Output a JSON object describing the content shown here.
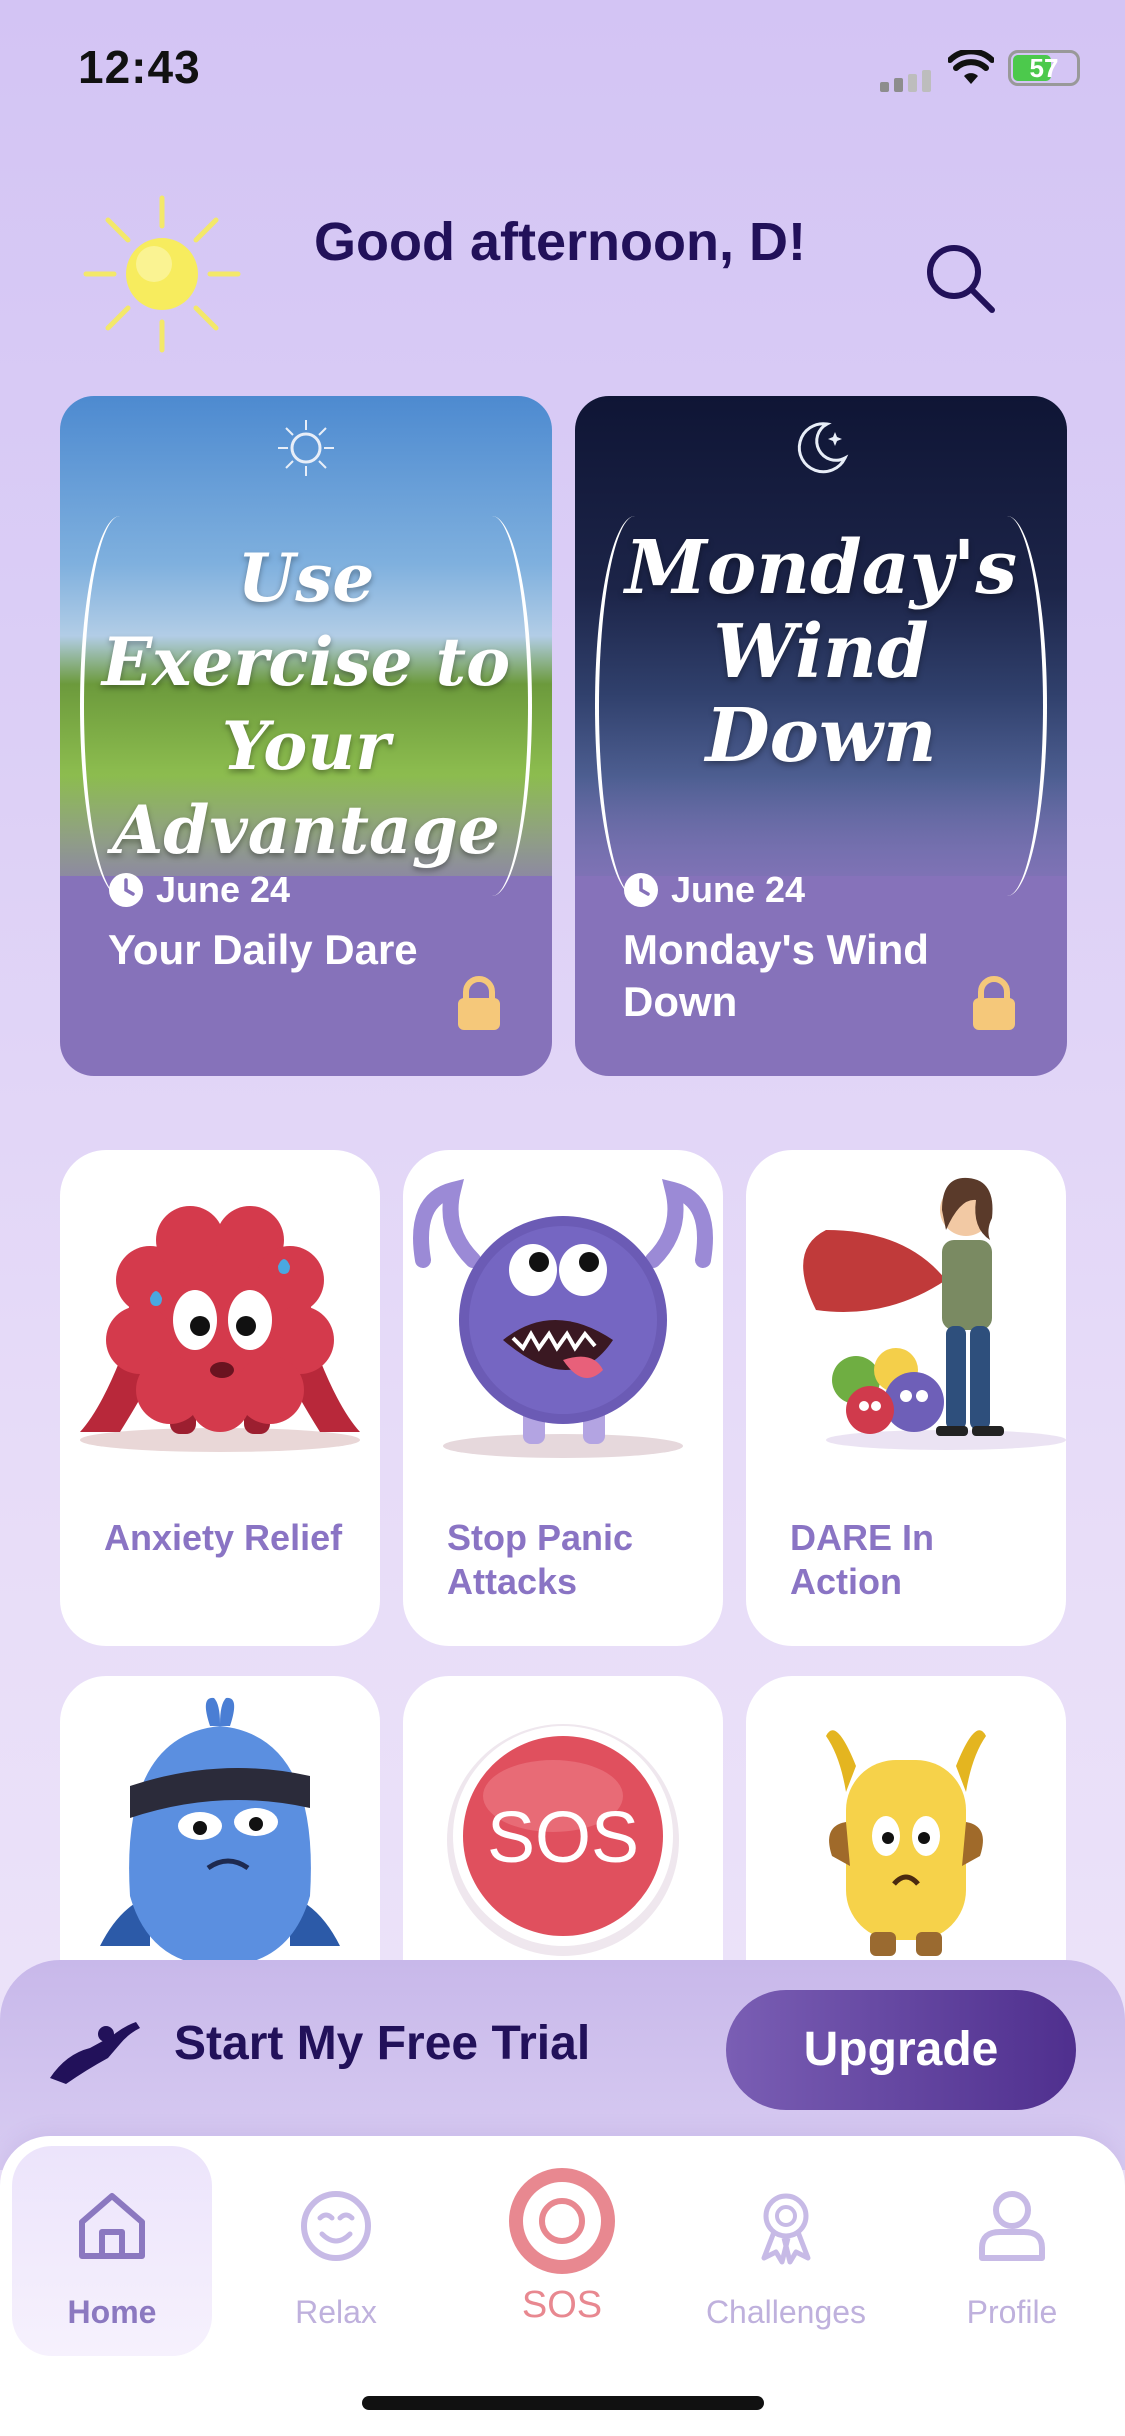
{
  "status_bar": {
    "time": "12:43",
    "battery": "57"
  },
  "header": {
    "greeting": "Good afternoon, D!"
  },
  "featured": [
    {
      "art_title": "Use Exercise to Your Advantage",
      "date": "June 24",
      "label": "Your Daily Dare",
      "emblem": "sun-emblem-icon"
    },
    {
      "art_title": "Monday's Wind Down",
      "date": "June 24",
      "label": "Monday's Wind Down",
      "emblem": "moon-emblem-icon"
    }
  ],
  "tiles": [
    {
      "label": "Anxiety Relief"
    },
    {
      "label": "Stop Panic Attacks"
    },
    {
      "label": "DARE In Action"
    }
  ],
  "tiles_row2": {
    "sos_text": "SOS"
  },
  "trial": {
    "label": "Start My Free Trial",
    "upgrade": "Upgrade"
  },
  "tabs": [
    {
      "label": "Home",
      "icon": "home-icon"
    },
    {
      "label": "Relax",
      "icon": "smile-icon"
    },
    {
      "label": "SOS",
      "icon": "lifebuoy-icon"
    },
    {
      "label": "Challenges",
      "icon": "ribbon-icon"
    },
    {
      "label": "Profile",
      "icon": "person-icon"
    }
  ],
  "colors": {
    "accent": "#8672ba",
    "dark": "#22115a",
    "sos": "#e0505e",
    "lock": "#f5c87a"
  }
}
